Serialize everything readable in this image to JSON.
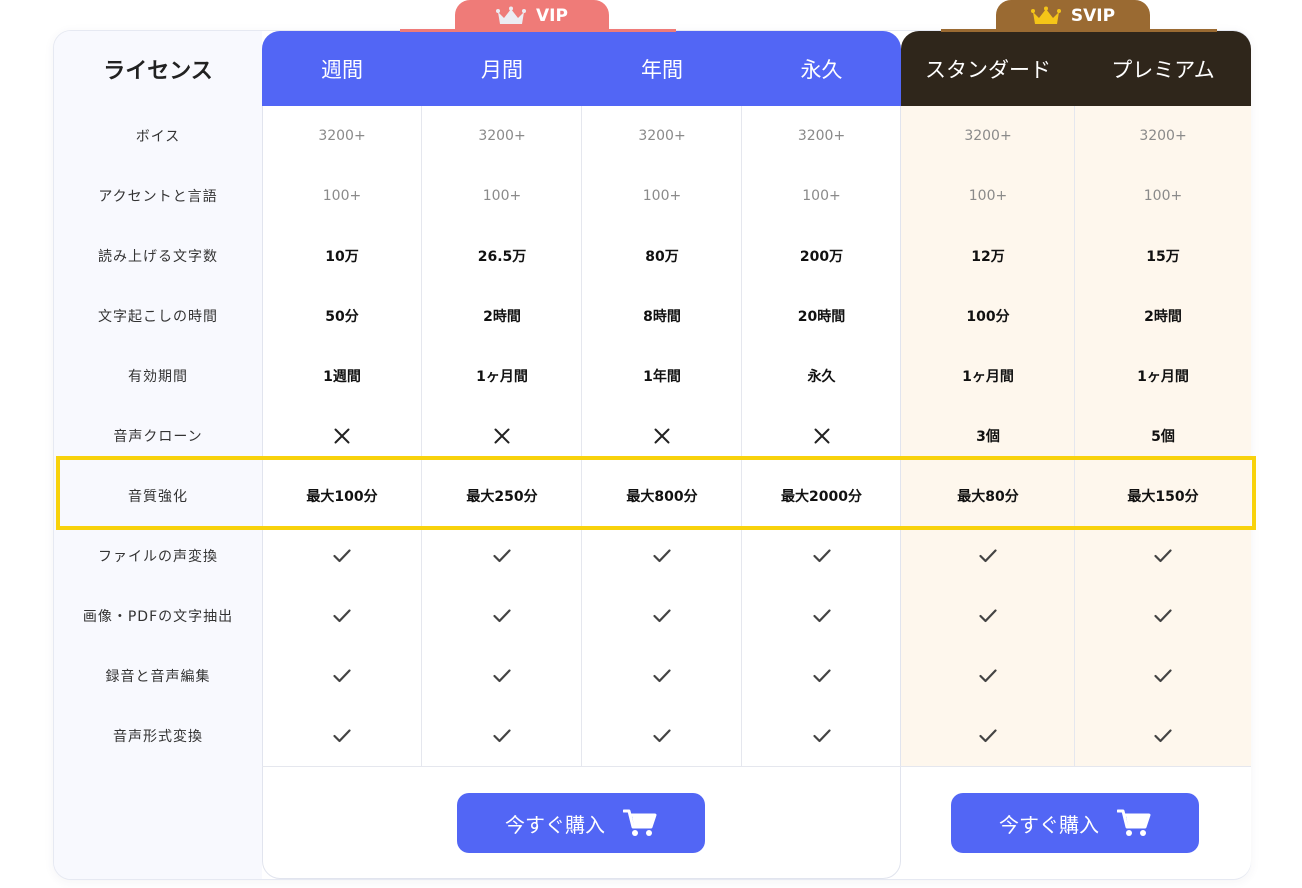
{
  "header": {
    "license_label": "ライセンス",
    "vip_tab": "VIP",
    "svip_tab": "SVIP",
    "vip_columns": [
      "週間",
      "月間",
      "年間",
      "永久"
    ],
    "svip_columns": [
      "スタンダード",
      "プレミアム"
    ]
  },
  "rows": [
    {
      "label": "ボイス",
      "style": "gray",
      "values": [
        "3200+",
        "3200+",
        "3200+",
        "3200+",
        "3200+",
        "3200+"
      ]
    },
    {
      "label": "アクセントと言語",
      "style": "gray",
      "values": [
        "100+",
        "100+",
        "100+",
        "100+",
        "100+",
        "100+"
      ]
    },
    {
      "label": "読み上げる文字数",
      "style": "bold",
      "values": [
        "10万",
        "26.5万",
        "80万",
        "200万",
        "12万",
        "15万"
      ]
    },
    {
      "label": "文字起こしの時間",
      "style": "bold",
      "values": [
        "50分",
        "2時間",
        "8時間",
        "20時間",
        "100分",
        "2時間"
      ]
    },
    {
      "label": "有効期間",
      "style": "bold",
      "values": [
        "1週間",
        "1ヶ月間",
        "1年間",
        "永久",
        "1ヶ月間",
        "1ヶ月間"
      ]
    },
    {
      "label": "音声クローン",
      "style": "bold",
      "values": [
        "x-icon",
        "x-icon",
        "x-icon",
        "x-icon",
        "3個",
        "5個"
      ]
    },
    {
      "label": "音質強化",
      "style": "bold",
      "highlight": true,
      "values": [
        "最大100分",
        "最大250分",
        "最大800分",
        "最大2000分",
        "最大80分",
        "最大150分"
      ]
    },
    {
      "label": "ファイルの声変換",
      "style": "icon",
      "values": [
        "check-icon",
        "check-icon",
        "check-icon",
        "check-icon",
        "check-icon",
        "check-icon"
      ]
    },
    {
      "label": "画像・PDFの文字抽出",
      "style": "icon",
      "values": [
        "check-icon",
        "check-icon",
        "check-icon",
        "check-icon",
        "check-icon",
        "check-icon"
      ]
    },
    {
      "label": "録音と音声編集",
      "style": "icon",
      "values": [
        "check-icon",
        "check-icon",
        "check-icon",
        "check-icon",
        "check-icon",
        "check-icon"
      ]
    },
    {
      "label": "音声形式変換",
      "style": "icon",
      "values": [
        "check-icon",
        "check-icon",
        "check-icon",
        "check-icon",
        "check-icon",
        "check-icon"
      ]
    }
  ],
  "buttons": {
    "vip_buy": "今すぐ購入",
    "svip_buy": "今すぐ購入",
    "icon": "cart-icon"
  },
  "colors": {
    "vip_blue": "#5266f5",
    "vip_tab": "#ef7b78",
    "svip_dark": "#2f261b",
    "svip_tab": "#9a6a32",
    "svip_bg": "#fef7ed",
    "highlight": "#f8d20c",
    "crown_vip": "#e8e8ee",
    "crown_svip": "#f5c518"
  }
}
